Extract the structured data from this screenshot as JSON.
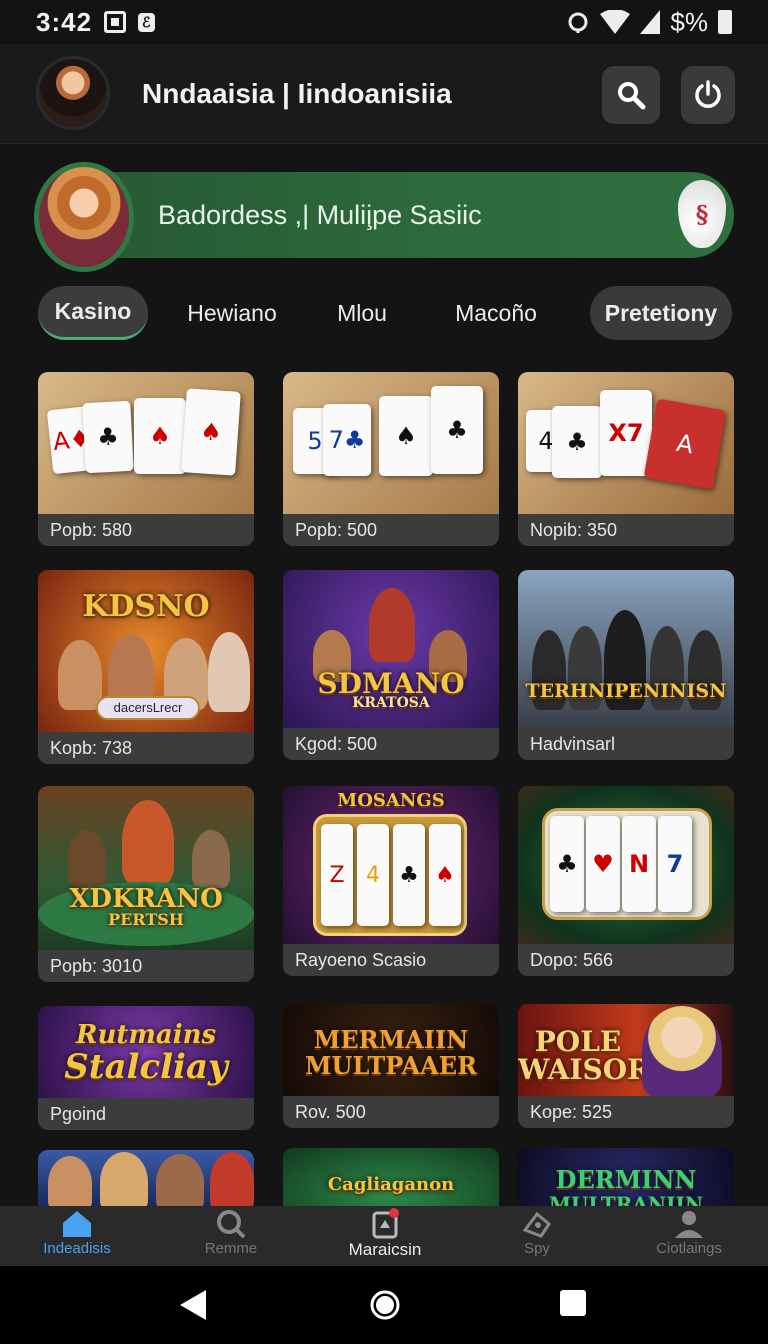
{
  "status_bar": {
    "time": "3:42",
    "battery": "$%"
  },
  "header": {
    "title": "Nndaaisia | Iindoanisiia"
  },
  "banner": {
    "text": "Badordess ,| Mulii̧pe Sasiic",
    "logo": "§"
  },
  "tabs": [
    {
      "label": "Kasino"
    },
    {
      "label": "Hewiano"
    },
    {
      "label": "Mlou"
    },
    {
      "label": "Macoño"
    },
    {
      "label": "Pretetiony"
    }
  ],
  "games": [
    {
      "label": "Popb: 580",
      "art": "cards-1"
    },
    {
      "label": "Popb: 500",
      "art": "cards-2"
    },
    {
      "label": "Nopib: 350",
      "art": "cards-3"
    },
    {
      "label": "Kopb: 738",
      "art": "kdsno",
      "title": "KDSNO",
      "badge": "dacersLrecr"
    },
    {
      "label": "Kgod: 500",
      "art": "sdmano",
      "title": "SDMANO",
      "subtitle": "KRATOSA"
    },
    {
      "label": "Hadvinsarl",
      "art": "terhnipeninisn",
      "title": "TERHNIPENINISN"
    },
    {
      "label": "Popb: 3010",
      "art": "xdkrano",
      "title": "XDKRANO",
      "subtitle": "PERTSH"
    },
    {
      "label": "Rayoeno Scasio",
      "art": "mosangs",
      "title": "MOSANGS"
    },
    {
      "label": "Dopo: 566",
      "art": "slot-green"
    },
    {
      "label": "Pgoind",
      "art": "rutmains",
      "title": "Rutmains",
      "title2": "Stalcliay"
    },
    {
      "label": "Rov. 500",
      "art": "mermainn",
      "title": "MERMAIIN",
      "title2": "MULTPAAER"
    },
    {
      "label": "Kope: 525",
      "art": "pole",
      "title": "POLE",
      "title2": "WAISOR"
    },
    {
      "label": "",
      "art": "people"
    },
    {
      "label": "",
      "art": "cagliaganon",
      "title": "Cagliaganon"
    },
    {
      "label": "",
      "art": "dermin",
      "title": "DERMINN",
      "title2": "MULTRANIIN"
    }
  ],
  "bottom_nav": [
    {
      "label": "Indeadisis",
      "icon": "home-icon",
      "state": "active"
    },
    {
      "label": "Remme",
      "icon": "search-icon",
      "state": "inactive"
    },
    {
      "label": "Maraicsin",
      "icon": "cards-icon",
      "state": "selected"
    },
    {
      "label": "Spy",
      "icon": "spy-icon",
      "state": "inactive"
    },
    {
      "label": "Ciotlaings",
      "icon": "profile-icon",
      "state": "inactive"
    }
  ],
  "colors": {
    "accent_green": "#2d6b3c",
    "active_blue": "#4aa3f0",
    "background": "#141414"
  }
}
